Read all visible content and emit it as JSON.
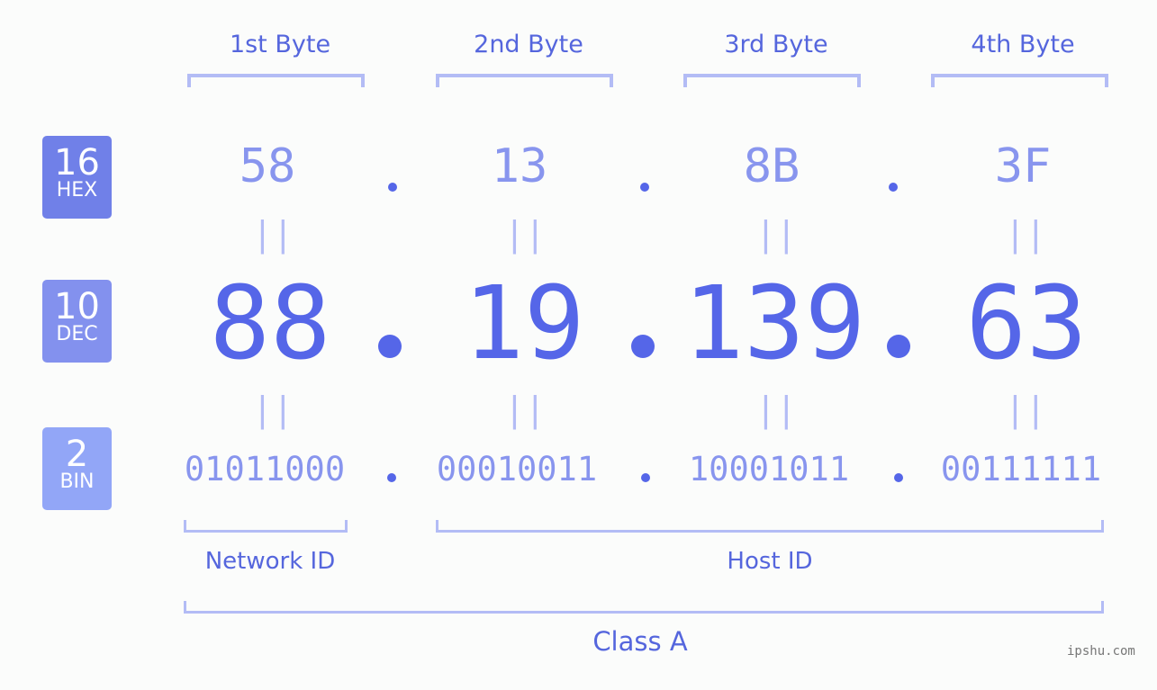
{
  "badges": [
    {
      "num": "16",
      "label": "HEX",
      "color": "#7080e8"
    },
    {
      "num": "10",
      "label": "DEC",
      "color": "#8391ee"
    },
    {
      "num": "2",
      "label": "BIN",
      "color": "#92a6f7"
    }
  ],
  "byte_headers": [
    "1st Byte",
    "2nd Byte",
    "3rd Byte",
    "4th Byte"
  ],
  "hex": [
    "58",
    "13",
    "8B",
    "3F"
  ],
  "dec": [
    "88",
    "19",
    "139",
    "63"
  ],
  "bin": [
    "01011000",
    "00010011",
    "10001011",
    "00111111"
  ],
  "equals_sign": "||",
  "network_id_label": "Network ID",
  "host_id_label": "Host ID",
  "class_label": "Class A",
  "watermark": "ipshu.com"
}
